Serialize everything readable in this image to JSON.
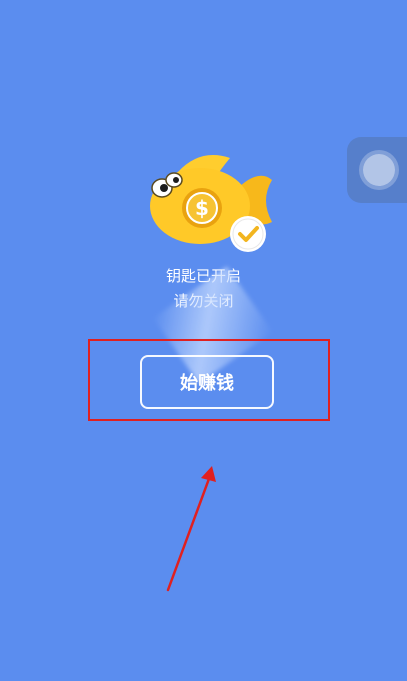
{
  "watermark": "",
  "status": {
    "line1": "钥匙已开启",
    "line2": "请勿关闭"
  },
  "button": {
    "label": "始赚钱"
  },
  "colors": {
    "background": "#5b8def",
    "accent_fish": "#ffc928",
    "highlight": "#e02020"
  },
  "icons": [
    "fish-mascot-icon",
    "dollar-coin-icon",
    "check-badge-icon",
    "floating-assist-icon"
  ]
}
